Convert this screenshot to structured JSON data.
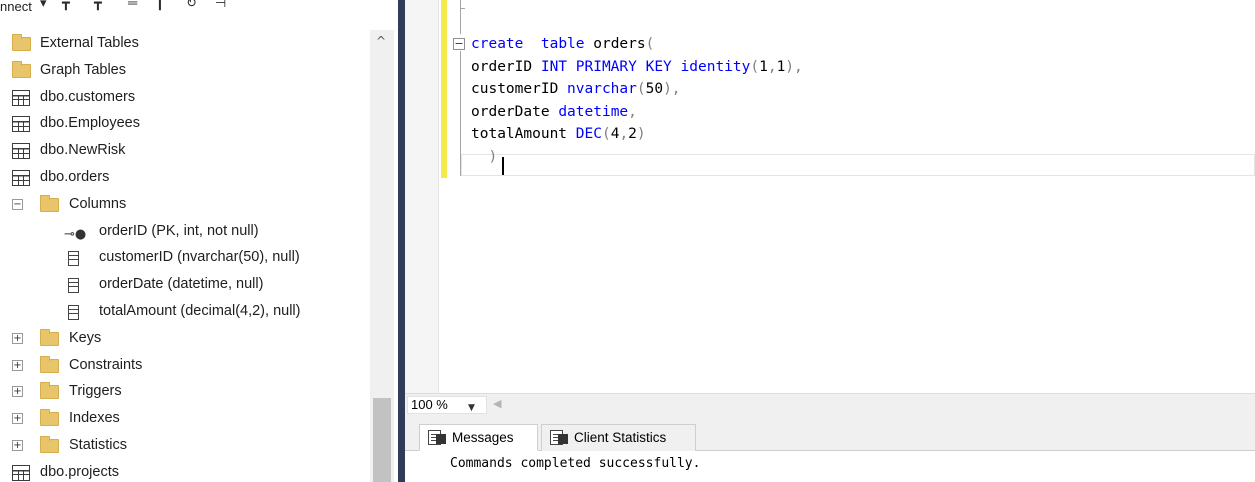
{
  "explorer": {
    "toolbar_label": "nnect",
    "tree": [
      {
        "label": "External Tables",
        "icon": "folder-icon"
      },
      {
        "label": "Graph Tables",
        "icon": "folder-icon"
      },
      {
        "label": "dbo.customers",
        "icon": "table-icon"
      },
      {
        "label": "dbo.Employees",
        "icon": "table-icon"
      },
      {
        "label": "dbo.NewRisk",
        "icon": "table-icon"
      },
      {
        "label": "dbo.orders",
        "icon": "table-icon"
      },
      {
        "label": "Columns",
        "icon": "folder-icon",
        "expander": "−"
      },
      {
        "label": "orderID (PK, int, not null)",
        "icon": "key-icon"
      },
      {
        "label": "customerID (nvarchar(50), null)",
        "icon": "column-icon"
      },
      {
        "label": "orderDate (datetime, null)",
        "icon": "column-icon"
      },
      {
        "label": "totalAmount (decimal(4,2), null)",
        "icon": "column-icon"
      },
      {
        "label": "Keys",
        "icon": "folder-icon",
        "expander": "+"
      },
      {
        "label": "Constraints",
        "icon": "folder-icon",
        "expander": "+"
      },
      {
        "label": "Triggers",
        "icon": "folder-icon",
        "expander": "+"
      },
      {
        "label": "Indexes",
        "icon": "folder-icon",
        "expander": "+"
      },
      {
        "label": "Statistics",
        "icon": "folder-icon",
        "expander": "+"
      },
      {
        "label": "dbo.projects",
        "icon": "table-icon"
      }
    ]
  },
  "editor": {
    "lines": [
      {
        "parts": [
          {
            "t": "create",
            "c": "kw"
          },
          {
            "t": "  ",
            "c": ""
          },
          {
            "t": "table",
            "c": "kw"
          },
          {
            "t": " orders",
            "c": ""
          },
          {
            "t": "(",
            "c": "gr"
          }
        ]
      },
      {
        "parts": [
          {
            "t": "orderID ",
            "c": ""
          },
          {
            "t": "INT PRIMARY KEY identity",
            "c": "kw"
          },
          {
            "t": "(",
            "c": "gr"
          },
          {
            "t": "1",
            "c": ""
          },
          {
            "t": ",",
            "c": "gr"
          },
          {
            "t": "1",
            "c": ""
          },
          {
            "t": "),",
            "c": "gr"
          }
        ]
      },
      {
        "parts": [
          {
            "t": "customerID ",
            "c": ""
          },
          {
            "t": "nvarchar",
            "c": "kw"
          },
          {
            "t": "(",
            "c": "gr"
          },
          {
            "t": "50",
            "c": ""
          },
          {
            "t": "),",
            "c": "gr"
          }
        ]
      },
      {
        "parts": [
          {
            "t": "orderDate ",
            "c": ""
          },
          {
            "t": "datetime",
            "c": "kw"
          },
          {
            "t": ",",
            "c": "gr"
          }
        ]
      },
      {
        "parts": [
          {
            "t": "totalAmount ",
            "c": ""
          },
          {
            "t": "DEC",
            "c": "kw"
          },
          {
            "t": "(",
            "c": "gr"
          },
          {
            "t": "4",
            "c": ""
          },
          {
            "t": ",",
            "c": "gr"
          },
          {
            "t": "2",
            "c": ""
          },
          {
            "t": ")",
            "c": "gr"
          }
        ]
      },
      {
        "parts": [
          {
            "t": "  )",
            "c": "gr"
          }
        ]
      }
    ],
    "collapse_symbol": "−"
  },
  "zoom": {
    "value": "100 %"
  },
  "results": {
    "tabs": [
      {
        "label": "Messages",
        "icon": "messages-icon",
        "active": true
      },
      {
        "label": "Client Statistics",
        "icon": "client-statistics-icon",
        "active": false
      }
    ],
    "message": "Commands completed successfully."
  },
  "colors": {
    "keyword": "#0000ff",
    "operator": "#808080",
    "change_bar": "#f6e94e",
    "divider": "#2f3c5a",
    "folder": "#e8c46a"
  }
}
